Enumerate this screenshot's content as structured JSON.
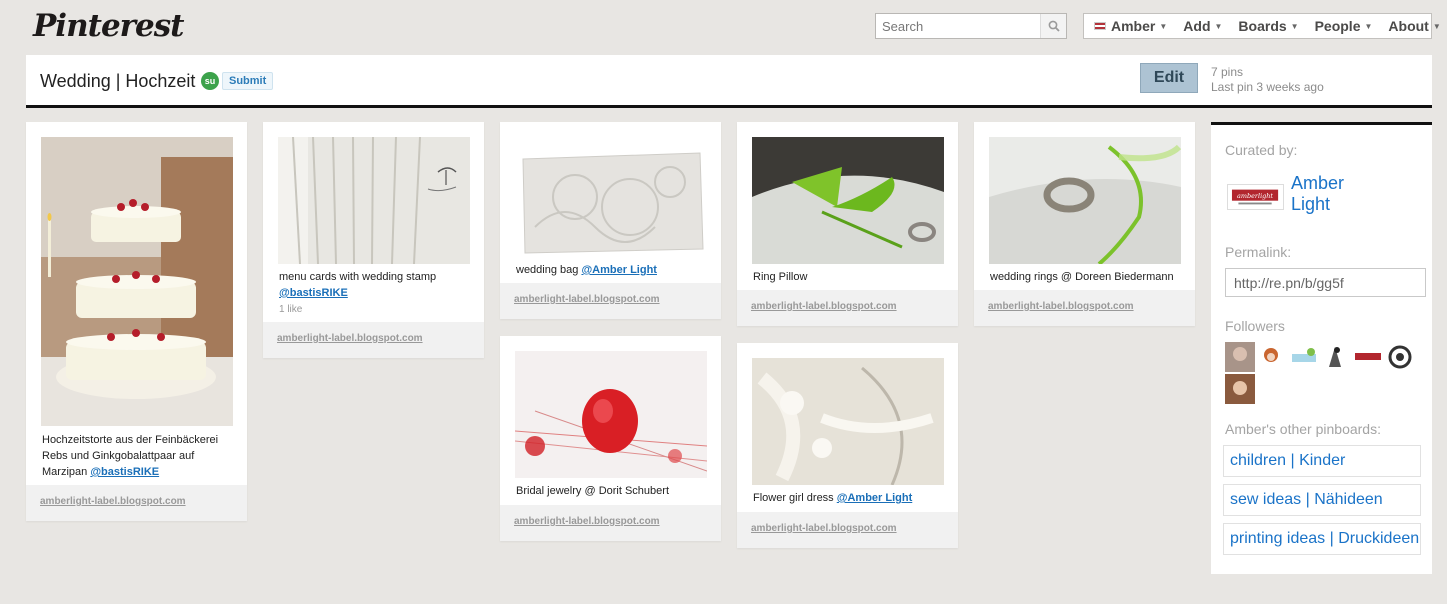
{
  "header": {
    "logo": "Pinterest",
    "search_placeholder": "Search",
    "nav": [
      {
        "label": "Amber"
      },
      {
        "label": "Add"
      },
      {
        "label": "Boards"
      },
      {
        "label": "People"
      },
      {
        "label": "About"
      }
    ]
  },
  "board": {
    "title": "Wedding | Hochzeit",
    "submit_label": "Submit",
    "edit_label": "Edit",
    "pin_count": "7 pins",
    "last_pin": "Last pin 3 weeks ago"
  },
  "pins": [
    {
      "text": "Hochzeitstorte aus der Feinbäckerei Rebs und Ginkgobalattpaar auf Marzipan",
      "mention": "@bastisRIKE",
      "source": "amberlight-label.blogspot.com"
    },
    {
      "text": "menu cards with wedding stamp",
      "mention": "@bastisRIKE",
      "likes": "1 like",
      "source": "amberlight-label.blogspot.com"
    },
    {
      "text": "wedding bag",
      "mention": "@Amber Light",
      "source": "amberlight-label.blogspot.com"
    },
    {
      "text": "Bridal jewelry @ Dorit Schubert",
      "source": "amberlight-label.blogspot.com"
    },
    {
      "text": "Ring Pillow",
      "source": "amberlight-label.blogspot.com"
    },
    {
      "text": "Flower girl dress",
      "mention": "@Amber Light",
      "source": "amberlight-label.blogspot.com"
    },
    {
      "text": "wedding rings @ Doreen Biedermann",
      "source": "amberlight-label.blogspot.com"
    }
  ],
  "sidebar": {
    "curated_label": "Curated by:",
    "curator_name": "Amber Light",
    "permalink_label": "Permalink:",
    "permalink_value": "http://re.pn/b/gg5f",
    "followers_label": "Followers",
    "other_boards_label": "Amber's other pinboards:",
    "other_boards": [
      "children | Kinder",
      "sew ideas | Nähideen",
      "printing ideas | Druckideen"
    ]
  }
}
